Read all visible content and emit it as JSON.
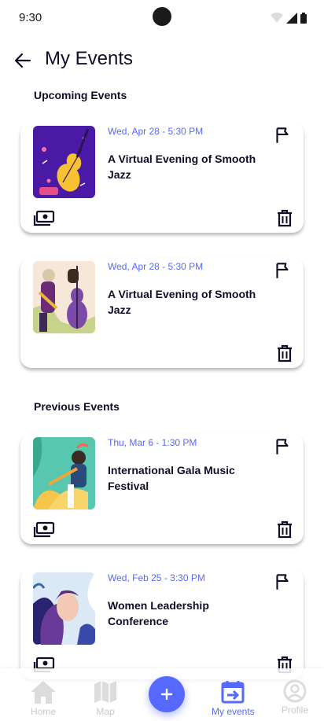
{
  "status_bar": {
    "time": "9:30"
  },
  "header": {
    "title": "My Events"
  },
  "sections": {
    "upcoming": "Upcoming Events",
    "previous": "Previous Events"
  },
  "events": [
    {
      "date": "Wed, Apr 28 - 5:30 PM",
      "title": "A Virtual Evening of Smooth Jazz"
    },
    {
      "date": "Wed, Apr 28 - 5:30 PM",
      "title": "A Virtual Evening of Smooth Jazz"
    },
    {
      "date": "Thu, Mar 6 - 1:30 PM",
      "title": "International Gala Music Festival"
    },
    {
      "date": "Wed, Feb 25 - 3:30 PM",
      "title": "Women Leadership Conference"
    }
  ],
  "nav": {
    "home": "Home",
    "map": "Map",
    "my_events": "My events",
    "profile": "Profile"
  },
  "colors": {
    "accent": "#5669ff",
    "text": "#120d26",
    "inactive": "#c9c9cf"
  },
  "icons": [
    "back-arrow-icon",
    "flag-icon",
    "ticket-icon",
    "trash-icon",
    "home-icon",
    "map-icon",
    "plus-icon",
    "calendar-icon",
    "profile-icon"
  ]
}
